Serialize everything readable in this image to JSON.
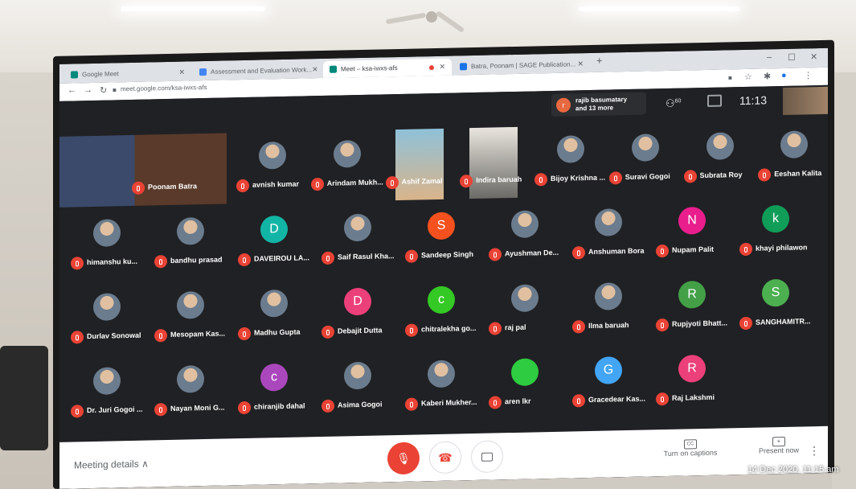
{
  "browser": {
    "tabs": [
      {
        "label": "Google Meet",
        "fav": "#00897b",
        "active": false
      },
      {
        "label": "Assessment and Evaluation Work...",
        "fav": "#4285f4",
        "active": false
      },
      {
        "label": "Meet – ksa-iwxs-afs",
        "fav": "#00897b",
        "active": true
      },
      {
        "label": "Batra, Poonam | SAGE Publication...",
        "fav": "#1a73e8",
        "active": false
      }
    ],
    "new_tab": "+",
    "url": "meet.google.com/ksa-iwxs-afs"
  },
  "meet": {
    "notification": {
      "initial": "r",
      "line1": "rajib basumatary",
      "line2": "and 13 more"
    },
    "people_count": "60",
    "time": "11:13"
  },
  "participants": [
    {
      "name": "Poonam Batra",
      "kind": "video"
    },
    {
      "name": "avnish kumar",
      "kind": "photo"
    },
    {
      "name": "Arindam Mukh...",
      "kind": "photo"
    },
    {
      "name": "Ashif Zamal",
      "kind": "video2"
    },
    {
      "name": "Indira baruah",
      "kind": "video3"
    },
    {
      "name": "Bijoy Krishna ...",
      "kind": "photo"
    },
    {
      "name": "Suravi Gogoi",
      "kind": "photo"
    },
    {
      "name": "Subrata Roy",
      "kind": "photo"
    },
    {
      "name": "Eeshan Kalita",
      "kind": "photo"
    },
    {
      "name": "himanshu ku...",
      "kind": "photo"
    },
    {
      "name": "bandhu prasad",
      "kind": "photo"
    },
    {
      "name": "DAVEIROU LA...",
      "kind": "letter",
      "letter": "D",
      "color": "#12b5a5"
    },
    {
      "name": "Saif Rasul Kha...",
      "kind": "photo"
    },
    {
      "name": "Sandeep Singh",
      "kind": "letter",
      "letter": "S",
      "color": "#f4511e"
    },
    {
      "name": "Ayushman De...",
      "kind": "photo"
    },
    {
      "name": "Anshuman Bora",
      "kind": "photo"
    },
    {
      "name": "Nupam Palit",
      "kind": "letter",
      "letter": "N",
      "color": "#e91e8c"
    },
    {
      "name": "khayi philawon",
      "kind": "letter",
      "letter": "k",
      "color": "#0f9d58"
    },
    {
      "name": "Durlav Sonowal",
      "kind": "photo"
    },
    {
      "name": "Mesopam Kas...",
      "kind": "photo"
    },
    {
      "name": "Madhu Gupta",
      "kind": "photo"
    },
    {
      "name": "Debajit Dutta",
      "kind": "letter",
      "letter": "D",
      "color": "#ec407a"
    },
    {
      "name": "chitralekha go...",
      "kind": "letter",
      "letter": "c",
      "color": "#34c924"
    },
    {
      "name": "raj pal",
      "kind": "photo"
    },
    {
      "name": "Ilma baruah",
      "kind": "photo"
    },
    {
      "name": "Rupjyoti Bhatt...",
      "kind": "letter",
      "letter": "R",
      "color": "#43a047"
    },
    {
      "name": "SANGHAMITR...",
      "kind": "letter",
      "letter": "S",
      "color": "#4caf50"
    },
    {
      "name": "Dr. Juri Gogoi ...",
      "kind": "photo"
    },
    {
      "name": "Nayan Moni G...",
      "kind": "photo"
    },
    {
      "name": "chiranjib dahal",
      "kind": "letter",
      "letter": "c",
      "color": "#ab47bc"
    },
    {
      "name": "Asima Gogoi",
      "kind": "photo"
    },
    {
      "name": "Kaberi Mukher...",
      "kind": "photo"
    },
    {
      "name": "aren lkr",
      "kind": "letter",
      "letter": "",
      "color": "#2ecc40"
    },
    {
      "name": "Gracedear Kas...",
      "kind": "letter",
      "letter": "G",
      "color": "#42a5f5"
    },
    {
      "name": "Raj Lakshmi",
      "kind": "letter",
      "letter": "R",
      "color": "#ec407a"
    }
  ],
  "bottom": {
    "meeting_details": "Meeting details",
    "captions": "Turn on captions",
    "captions_icon": "CC",
    "present": "Present now"
  },
  "timestamp": "14 Dec 2020, 11:15 am"
}
